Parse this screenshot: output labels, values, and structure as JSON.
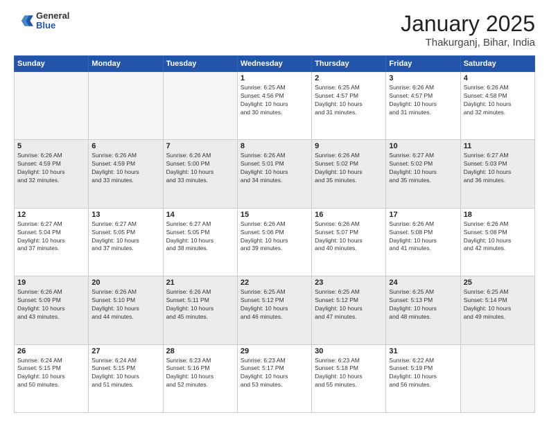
{
  "header": {
    "logo_general": "General",
    "logo_blue": "Blue",
    "title": "January 2025",
    "location": "Thakurganj, Bihar, India"
  },
  "weekdays": [
    "Sunday",
    "Monday",
    "Tuesday",
    "Wednesday",
    "Thursday",
    "Friday",
    "Saturday"
  ],
  "weeks": [
    [
      {
        "day": "",
        "info": ""
      },
      {
        "day": "",
        "info": ""
      },
      {
        "day": "",
        "info": ""
      },
      {
        "day": "1",
        "info": "Sunrise: 6:25 AM\nSunset: 4:56 PM\nDaylight: 10 hours\nand 30 minutes."
      },
      {
        "day": "2",
        "info": "Sunrise: 6:25 AM\nSunset: 4:57 PM\nDaylight: 10 hours\nand 31 minutes."
      },
      {
        "day": "3",
        "info": "Sunrise: 6:26 AM\nSunset: 4:57 PM\nDaylight: 10 hours\nand 31 minutes."
      },
      {
        "day": "4",
        "info": "Sunrise: 6:26 AM\nSunset: 4:58 PM\nDaylight: 10 hours\nand 32 minutes."
      }
    ],
    [
      {
        "day": "5",
        "info": "Sunrise: 6:26 AM\nSunset: 4:59 PM\nDaylight: 10 hours\nand 32 minutes."
      },
      {
        "day": "6",
        "info": "Sunrise: 6:26 AM\nSunset: 4:59 PM\nDaylight: 10 hours\nand 33 minutes."
      },
      {
        "day": "7",
        "info": "Sunrise: 6:26 AM\nSunset: 5:00 PM\nDaylight: 10 hours\nand 33 minutes."
      },
      {
        "day": "8",
        "info": "Sunrise: 6:26 AM\nSunset: 5:01 PM\nDaylight: 10 hours\nand 34 minutes."
      },
      {
        "day": "9",
        "info": "Sunrise: 6:26 AM\nSunset: 5:02 PM\nDaylight: 10 hours\nand 35 minutes."
      },
      {
        "day": "10",
        "info": "Sunrise: 6:27 AM\nSunset: 5:02 PM\nDaylight: 10 hours\nand 35 minutes."
      },
      {
        "day": "11",
        "info": "Sunrise: 6:27 AM\nSunset: 5:03 PM\nDaylight: 10 hours\nand 36 minutes."
      }
    ],
    [
      {
        "day": "12",
        "info": "Sunrise: 6:27 AM\nSunset: 5:04 PM\nDaylight: 10 hours\nand 37 minutes."
      },
      {
        "day": "13",
        "info": "Sunrise: 6:27 AM\nSunset: 5:05 PM\nDaylight: 10 hours\nand 37 minutes."
      },
      {
        "day": "14",
        "info": "Sunrise: 6:27 AM\nSunset: 5:05 PM\nDaylight: 10 hours\nand 38 minutes."
      },
      {
        "day": "15",
        "info": "Sunrise: 6:26 AM\nSunset: 5:06 PM\nDaylight: 10 hours\nand 39 minutes."
      },
      {
        "day": "16",
        "info": "Sunrise: 6:26 AM\nSunset: 5:07 PM\nDaylight: 10 hours\nand 40 minutes."
      },
      {
        "day": "17",
        "info": "Sunrise: 6:26 AM\nSunset: 5:08 PM\nDaylight: 10 hours\nand 41 minutes."
      },
      {
        "day": "18",
        "info": "Sunrise: 6:26 AM\nSunset: 5:08 PM\nDaylight: 10 hours\nand 42 minutes."
      }
    ],
    [
      {
        "day": "19",
        "info": "Sunrise: 6:26 AM\nSunset: 5:09 PM\nDaylight: 10 hours\nand 43 minutes."
      },
      {
        "day": "20",
        "info": "Sunrise: 6:26 AM\nSunset: 5:10 PM\nDaylight: 10 hours\nand 44 minutes."
      },
      {
        "day": "21",
        "info": "Sunrise: 6:26 AM\nSunset: 5:11 PM\nDaylight: 10 hours\nand 45 minutes."
      },
      {
        "day": "22",
        "info": "Sunrise: 6:25 AM\nSunset: 5:12 PM\nDaylight: 10 hours\nand 46 minutes."
      },
      {
        "day": "23",
        "info": "Sunrise: 6:25 AM\nSunset: 5:12 PM\nDaylight: 10 hours\nand 47 minutes."
      },
      {
        "day": "24",
        "info": "Sunrise: 6:25 AM\nSunset: 5:13 PM\nDaylight: 10 hours\nand 48 minutes."
      },
      {
        "day": "25",
        "info": "Sunrise: 6:25 AM\nSunset: 5:14 PM\nDaylight: 10 hours\nand 49 minutes."
      }
    ],
    [
      {
        "day": "26",
        "info": "Sunrise: 6:24 AM\nSunset: 5:15 PM\nDaylight: 10 hours\nand 50 minutes."
      },
      {
        "day": "27",
        "info": "Sunrise: 6:24 AM\nSunset: 5:15 PM\nDaylight: 10 hours\nand 51 minutes."
      },
      {
        "day": "28",
        "info": "Sunrise: 6:23 AM\nSunset: 5:16 PM\nDaylight: 10 hours\nand 52 minutes."
      },
      {
        "day": "29",
        "info": "Sunrise: 6:23 AM\nSunset: 5:17 PM\nDaylight: 10 hours\nand 53 minutes."
      },
      {
        "day": "30",
        "info": "Sunrise: 6:23 AM\nSunset: 5:18 PM\nDaylight: 10 hours\nand 55 minutes."
      },
      {
        "day": "31",
        "info": "Sunrise: 6:22 AM\nSunset: 5:19 PM\nDaylight: 10 hours\nand 56 minutes."
      },
      {
        "day": "",
        "info": ""
      }
    ]
  ]
}
